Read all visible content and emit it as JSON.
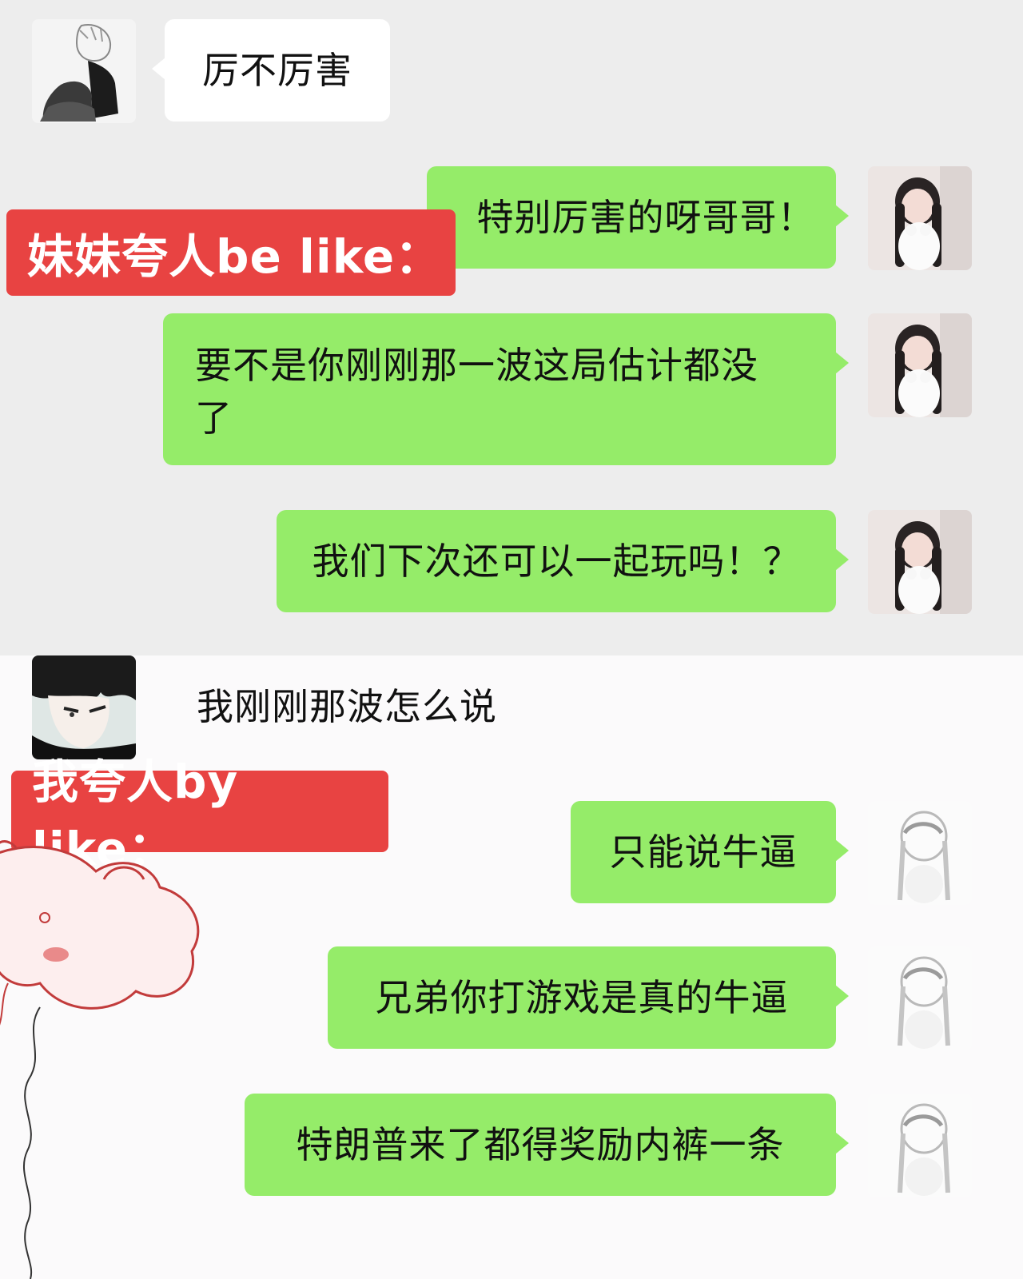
{
  "top_section": {
    "caption": "妹妹夸人be like：",
    "messages": [
      {
        "side": "left",
        "text": "厉不厉害"
      },
      {
        "side": "right",
        "text": "特别厉害的呀哥哥！"
      },
      {
        "side": "right",
        "text_line1": "要不是你刚刚那一波这局估计都没",
        "text_line2": "了"
      },
      {
        "side": "right",
        "text": "我们下次还可以一起玩吗！？"
      }
    ]
  },
  "bottom_section": {
    "caption": "我夸人by like：",
    "messages": [
      {
        "side": "left",
        "text": "我刚刚那波怎么说"
      },
      {
        "side": "right",
        "text": "只能说牛逼"
      },
      {
        "side": "right",
        "text": "兄弟你打游戏是真的牛逼"
      },
      {
        "side": "right",
        "text": "特朗普来了都得奖励内裤一条"
      }
    ]
  },
  "colors": {
    "sent_bubble": "#95ec69",
    "received_bubble": "#ffffff",
    "caption_bg": "#e84342",
    "top_bg": "#ededed",
    "bottom_bg": "#fbfafb"
  },
  "icons": {
    "left_avatar_top": "sketch-boy-avatar-icon",
    "right_avatar_top": "girl-photo-avatar-icon",
    "left_avatar_bottom": "anime-boy-avatar-icon",
    "right_avatar_bottom": "faded-girl-avatar-icon"
  }
}
